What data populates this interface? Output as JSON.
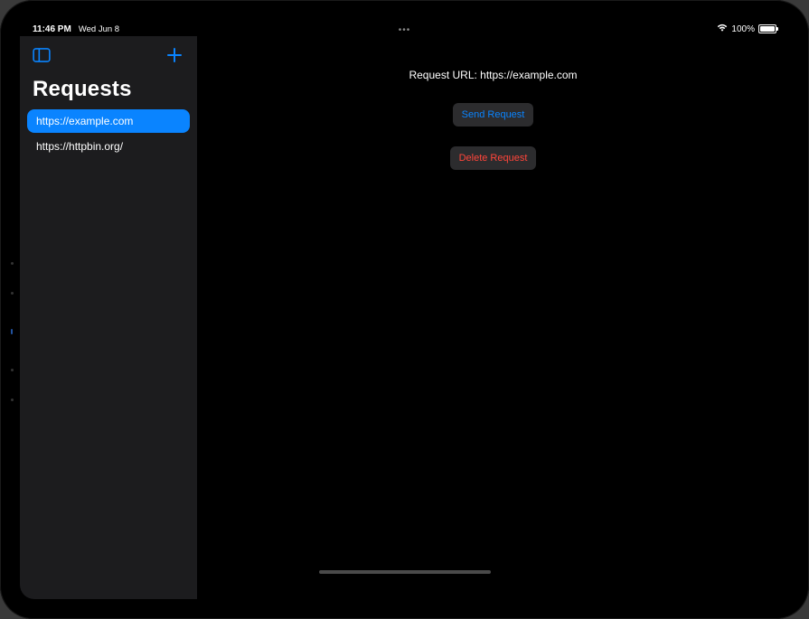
{
  "status_bar": {
    "time": "11:46 PM",
    "date": "Wed Jun 8",
    "battery_pct": "100%",
    "ellipsis": "•••"
  },
  "sidebar": {
    "title": "Requests",
    "items": [
      {
        "label": "https://example.com",
        "selected": true
      },
      {
        "label": "https://httpbin.org/",
        "selected": false
      }
    ]
  },
  "main": {
    "url_prefix": "Request URL: ",
    "url_value": "https://example.com",
    "send_label": "Send Request",
    "delete_label": "Delete Request"
  }
}
